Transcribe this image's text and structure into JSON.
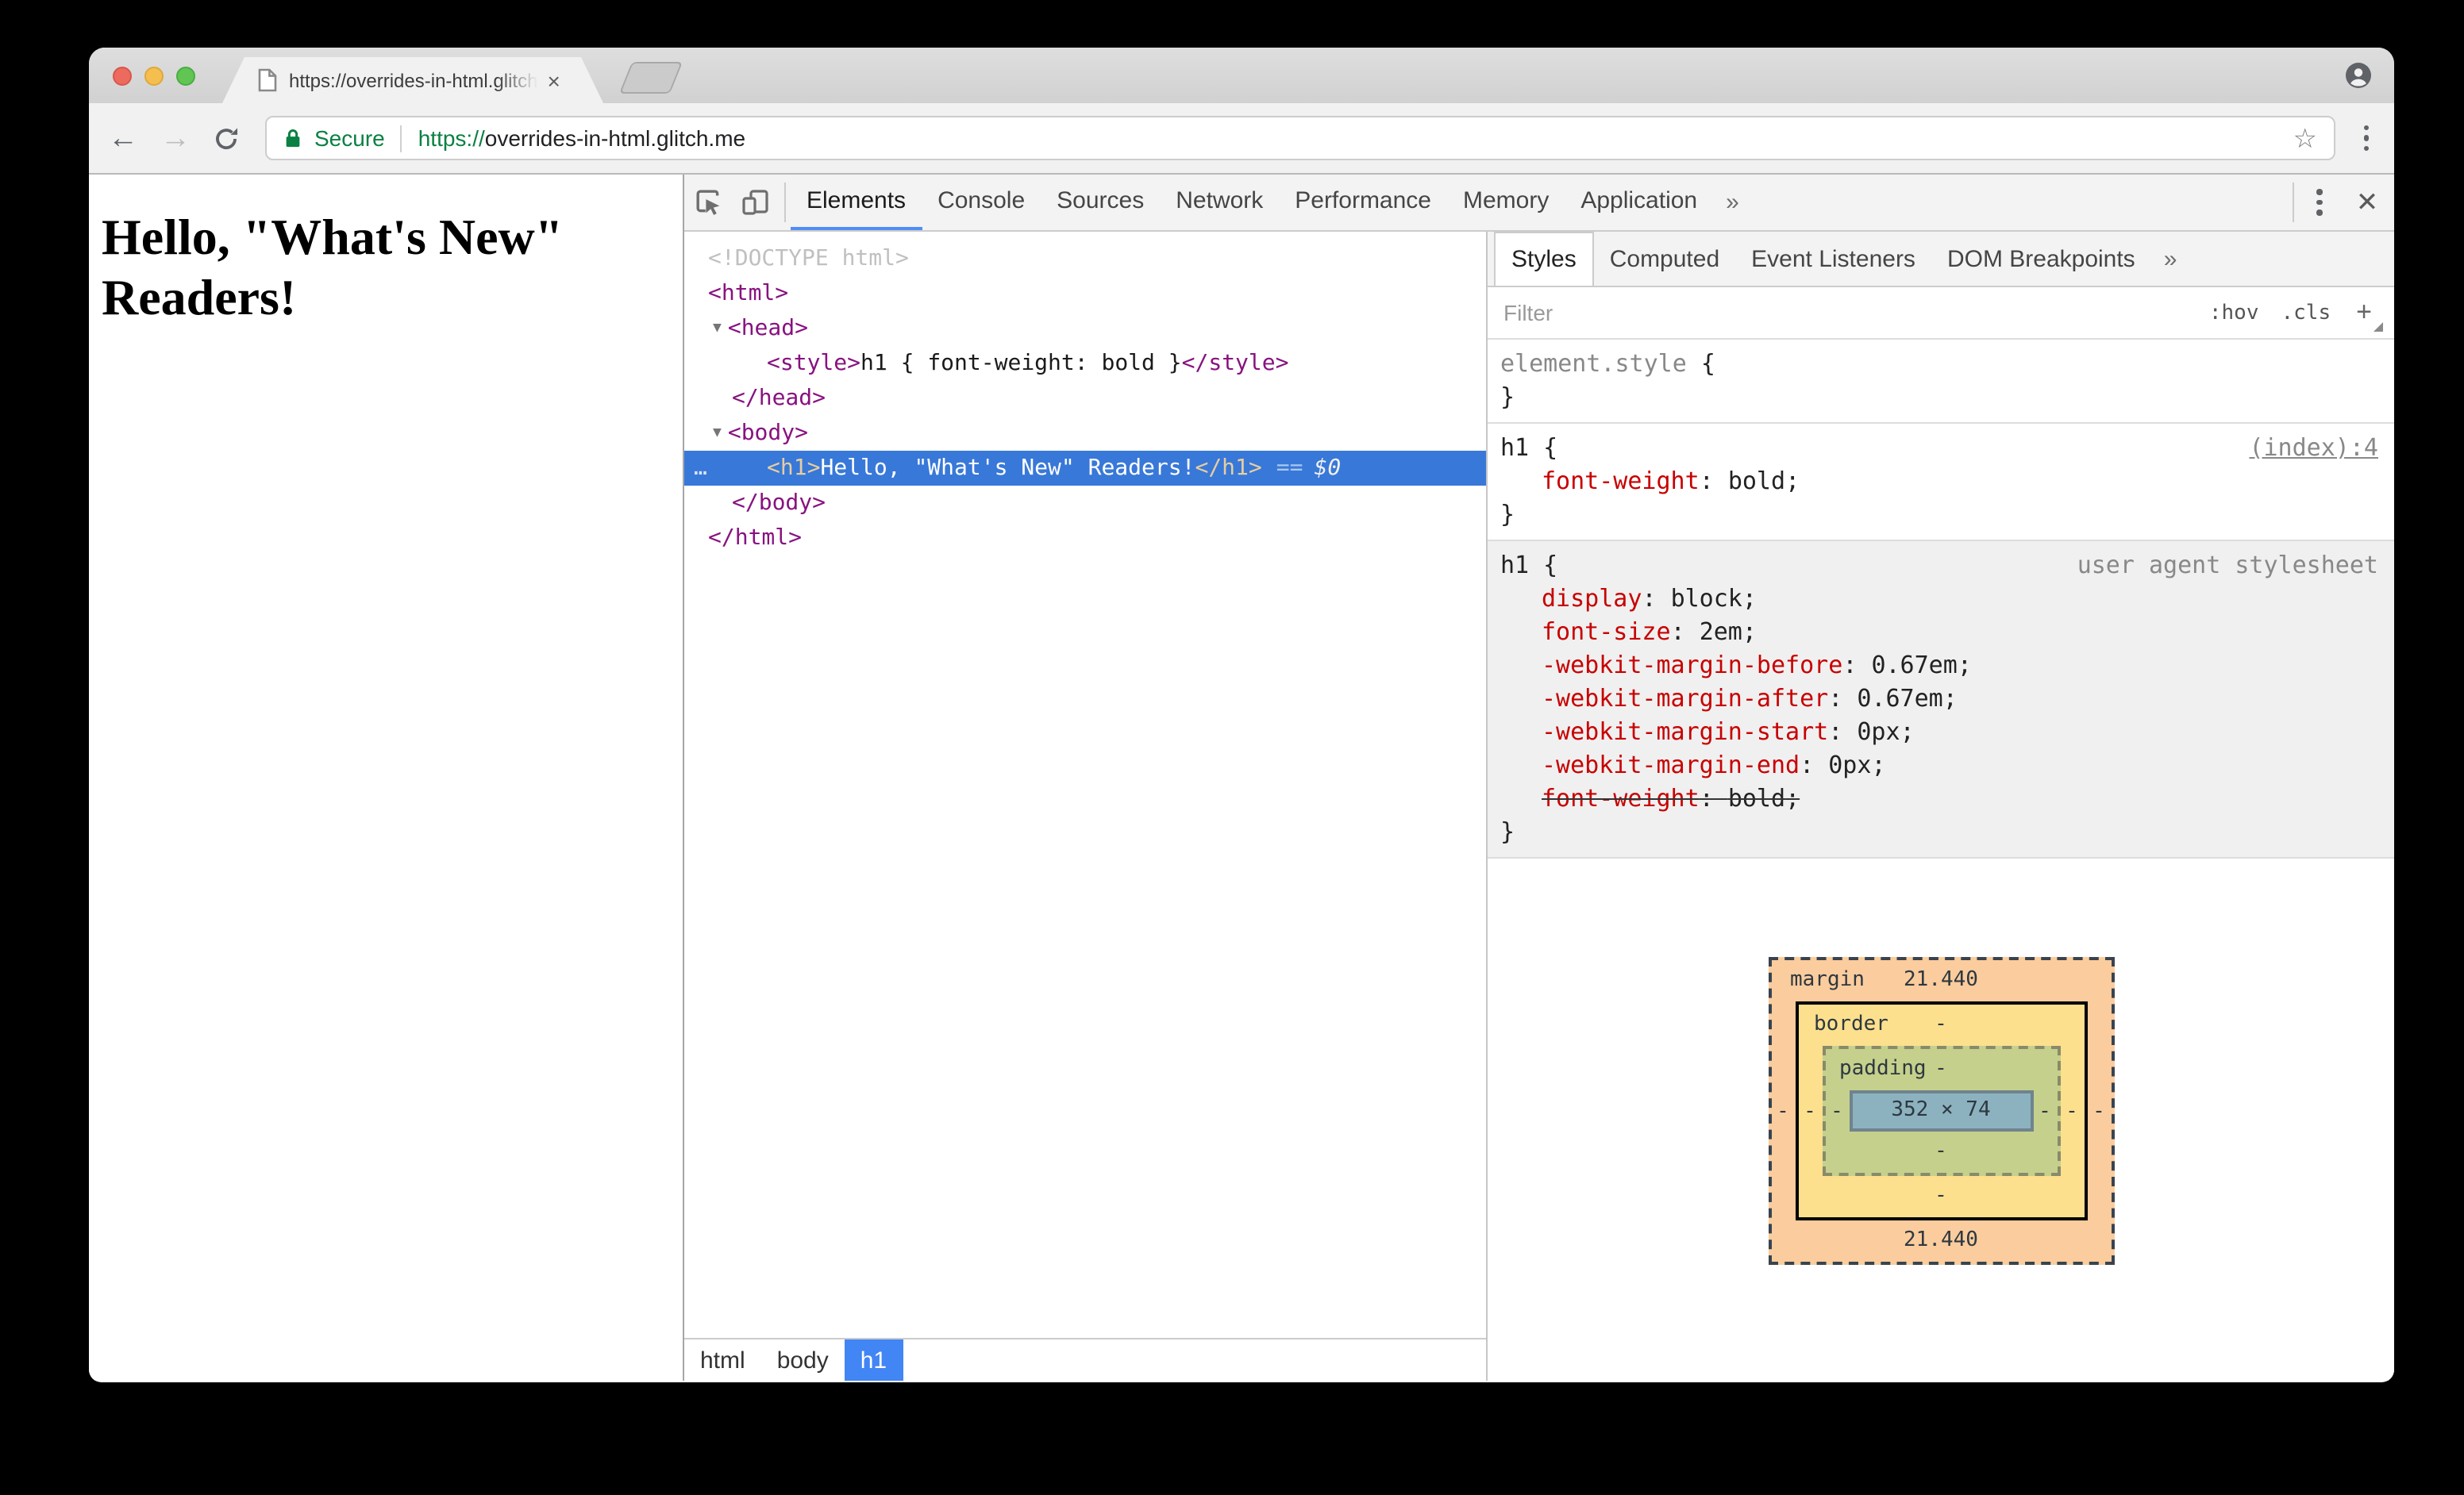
{
  "colors": {
    "accent_blue": "#4285f4",
    "tab_underline_blue": "#4e8ef7",
    "selection_blue": "#3878d8",
    "tag_purple": "#881280",
    "css_property_red": "#c80000",
    "secure_green": "#0b8043",
    "box_margin": "#fbcc9d",
    "box_border": "#fce08d",
    "box_padding": "#c5d08c",
    "box_content": "#8cb2c0"
  },
  "browser": {
    "tab_title": "https://overrides-in-html.glitch",
    "tab_close": "×",
    "secure_label": "Secure",
    "url_scheme": "https://",
    "url_rest": "overrides-in-html.glitch.me",
    "back_arrow": "←",
    "forward_arrow": "→",
    "star": "☆"
  },
  "page": {
    "heading": "Hello, \"What's New\" Readers!"
  },
  "devtools": {
    "panel_tabs": [
      {
        "label": "Elements",
        "selected": true
      },
      {
        "label": "Console",
        "selected": false
      },
      {
        "label": "Sources",
        "selected": false
      },
      {
        "label": "Network",
        "selected": false
      },
      {
        "label": "Performance",
        "selected": false
      },
      {
        "label": "Memory",
        "selected": false
      },
      {
        "label": "Application",
        "selected": false
      }
    ],
    "panel_overflow": "»",
    "close_button": "✕",
    "syntax": {
      "open": "{",
      "close": "}",
      "colon": ": ",
      "semi": ";"
    },
    "tree": {
      "rows": [
        {
          "indent": 1,
          "selected": false,
          "tokens": [
            {
              "t": "doctype",
              "s": "<!DOCTYPE html>"
            }
          ]
        },
        {
          "indent": 1,
          "selected": false,
          "tokens": [
            {
              "t": "tag",
              "s": "<html>"
            }
          ]
        },
        {
          "indent": 0,
          "selected": false,
          "tokens": [
            {
              "t": "arrow",
              "s": "▼"
            },
            {
              "t": "tag",
              "s": "<head>"
            }
          ]
        },
        {
          "indent": 3,
          "selected": false,
          "tokens": [
            {
              "t": "tag",
              "s": "<style>"
            },
            {
              "t": "text",
              "s": "h1 { font-weight: bold }"
            },
            {
              "t": "tag",
              "s": "</style>"
            }
          ]
        },
        {
          "indent": 2,
          "selected": false,
          "tokens": [
            {
              "t": "tag",
              "s": "</head>"
            }
          ]
        },
        {
          "indent": 0,
          "selected": false,
          "tokens": [
            {
              "t": "arrow",
              "s": "▼"
            },
            {
              "t": "tag",
              "s": "<body>"
            }
          ]
        },
        {
          "indent": 3,
          "selected": true,
          "tokens": [
            {
              "t": "more",
              "s": "…"
            },
            {
              "t": "tag",
              "s": "<h1>"
            },
            {
              "t": "text",
              "s": "Hello, \"What's New\" Readers!"
            },
            {
              "t": "tag",
              "s": "</h1>"
            },
            {
              "t": "eq",
              "s": "=="
            },
            {
              "t": "dollar",
              "s": "$0"
            }
          ]
        },
        {
          "indent": 2,
          "selected": false,
          "tokens": [
            {
              "t": "tag",
              "s": "</body>"
            }
          ]
        },
        {
          "indent": 1,
          "selected": false,
          "tokens": [
            {
              "t": "tag",
              "s": "</html>"
            }
          ]
        }
      ]
    },
    "sidebar": {
      "tabs": [
        {
          "label": "Styles",
          "selected": true
        },
        {
          "label": "Computed",
          "selected": false
        },
        {
          "label": "Event Listeners",
          "selected": false
        },
        {
          "label": "DOM Breakpoints",
          "selected": false
        }
      ],
      "overflow": "»",
      "filter_placeholder": "Filter",
      "hov_label": ":hov",
      "cls_label": ".cls",
      "new_rule_label": "+"
    },
    "rules": [
      {
        "selector": "element.style",
        "selector_gray": true,
        "link": "",
        "origin": "",
        "gray_bg": false,
        "props": []
      },
      {
        "selector": "h1",
        "selector_gray": false,
        "link": "(index):4",
        "origin": "",
        "gray_bg": false,
        "props": [
          {
            "name": "font-weight",
            "value": "bold",
            "struck": false
          }
        ]
      },
      {
        "selector": "h1",
        "selector_gray": false,
        "link": "",
        "origin": "user agent stylesheet",
        "gray_bg": true,
        "props": [
          {
            "name": "display",
            "value": "block",
            "struck": false
          },
          {
            "name": "font-size",
            "value": "2em",
            "struck": false
          },
          {
            "name": "-webkit-margin-before",
            "value": "0.67em",
            "struck": false
          },
          {
            "name": "-webkit-margin-after",
            "value": "0.67em",
            "struck": false
          },
          {
            "name": "-webkit-margin-start",
            "value": "0px",
            "struck": false
          },
          {
            "name": "-webkit-margin-end",
            "value": "0px",
            "struck": false
          },
          {
            "name": "font-weight",
            "value": "bold",
            "struck": true
          }
        ]
      }
    ],
    "breadcrumbs": [
      {
        "label": "html",
        "selected": false
      },
      {
        "label": "body",
        "selected": false
      },
      {
        "label": "h1",
        "selected": true
      }
    ],
    "box_model": {
      "margin_label": "margin",
      "margin_top": "21.440",
      "margin_bottom": "21.440",
      "margin_left": "-",
      "margin_right": "-",
      "border_label": "border",
      "border_top": "-",
      "border_bottom": "-",
      "border_left": "-",
      "border_right": "-",
      "padding_label": "padding",
      "padding_top": "-",
      "padding_bottom": "-",
      "padding_left": "-",
      "padding_right": "-",
      "content": "352 × 74"
    }
  }
}
